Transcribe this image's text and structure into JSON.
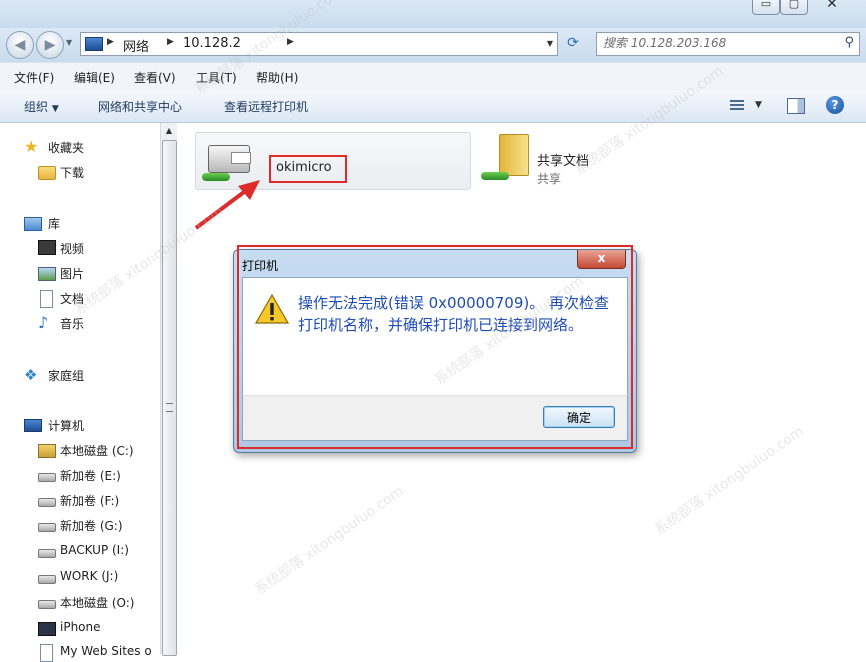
{
  "window": {
    "min_label": "▭",
    "max_label": "▢",
    "close_label": "✕"
  },
  "address": {
    "crumbs": [
      "网络",
      "10.128.2"
    ],
    "search_placeholder": "搜索 10.128.203.168"
  },
  "menu": [
    "文件(F)",
    "编辑(E)",
    "查看(V)",
    "工具(T)",
    "帮助(H)"
  ],
  "commands": {
    "organize": "组织",
    "network_center": "网络和共享中心",
    "remote_printers": "查看远程打印机"
  },
  "nav": {
    "favorites": "收藏夹",
    "downloads": "下载",
    "libraries": "库",
    "videos": "视频",
    "pictures": "图片",
    "documents": "文档",
    "music": "音乐",
    "homegroup": "家庭组",
    "computer": "计算机",
    "drives": [
      "本地磁盘 (C:)",
      "新加卷 (E:)",
      "新加卷 (F:)",
      "新加卷 (G:)",
      "BACKUP (I:)",
      "WORK (J:)",
      "本地磁盘 (O:)",
      "iPhone",
      "My Web Sites o"
    ]
  },
  "items": {
    "printer_name": "okimicro",
    "share_name": "共享文档",
    "share_sub": "共享"
  },
  "dialog": {
    "title": "打印机",
    "close": "x",
    "message": "操作无法完成(错误 0x00000709)。 再次检查打印机名称，并确保打印机已连接到网络。",
    "ok": "确定"
  },
  "watermark": "系统部落 xitongbuluo.com",
  "colors": {
    "highlight_red": "#dc2b2b",
    "message_blue": "#1e4cb5"
  }
}
